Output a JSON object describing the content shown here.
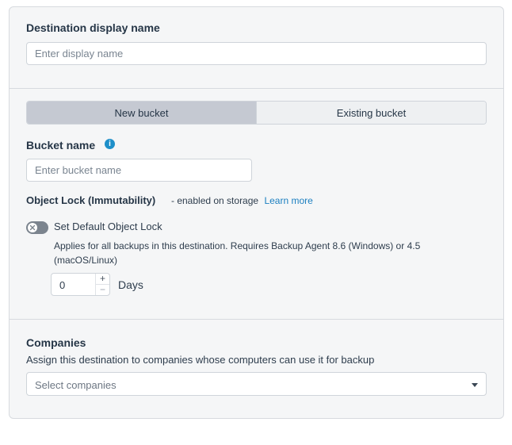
{
  "display_name": {
    "label": "Destination display name",
    "placeholder": "Enter display name"
  },
  "bucket_type": {
    "options": [
      "New bucket",
      "Existing bucket"
    ],
    "selected": "New bucket"
  },
  "bucket_name": {
    "label": "Bucket name",
    "info_icon": "i",
    "placeholder": "Enter bucket name"
  },
  "object_lock": {
    "label": "Object Lock (Immutability)",
    "note": "- enabled on storage",
    "learn_more": "Learn more",
    "toggle_label": "Set Default Object Lock",
    "toggle_state": "off",
    "description": "Applies for all backups in this destination. Requires Backup Agent 8.6 (Windows) or 4.5 (macOS/Linux)",
    "days_value": "0",
    "days_unit": "Days",
    "plus": "+",
    "minus": "−"
  },
  "companies": {
    "label": "Companies",
    "description": "Assign this destination to companies whose computers can use it for backup",
    "placeholder": "Select companies"
  },
  "colors": {
    "accent": "#1b7fc0",
    "selected_segment": "#c5c9d2"
  }
}
